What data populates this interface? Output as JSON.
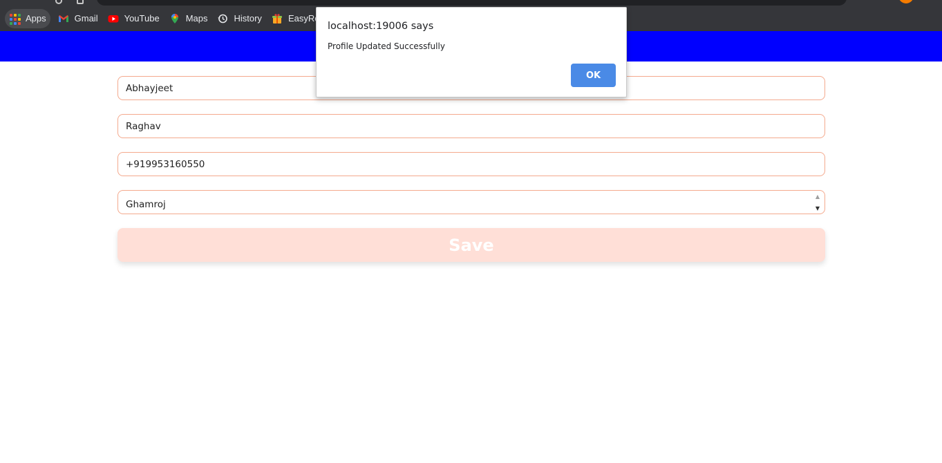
{
  "bookmarks": [
    {
      "label": "Apps",
      "icon": "apps-grid-icon"
    },
    {
      "label": "Gmail",
      "icon": "gmail-icon"
    },
    {
      "label": "YouTube",
      "icon": "youtube-icon"
    },
    {
      "label": "Maps",
      "icon": "maps-icon"
    },
    {
      "label": "History",
      "icon": "history-icon"
    },
    {
      "label": "EasyRewa",
      "icon": "easyrewards-icon"
    }
  ],
  "header": {
    "color": "#0000ff"
  },
  "form": {
    "first_name": "Abhayjeet",
    "last_name": "Raghav",
    "phone": "+919953160550",
    "city": "Ghamroj",
    "save_label": "Save",
    "field_border_color": "#f4a98d",
    "save_bg_color": "#ffdfd7"
  },
  "dialog": {
    "title": "localhost:19006 says",
    "message": "Profile Updated Successfully",
    "ok_label": "OK",
    "ok_color": "#4a8ae6"
  }
}
